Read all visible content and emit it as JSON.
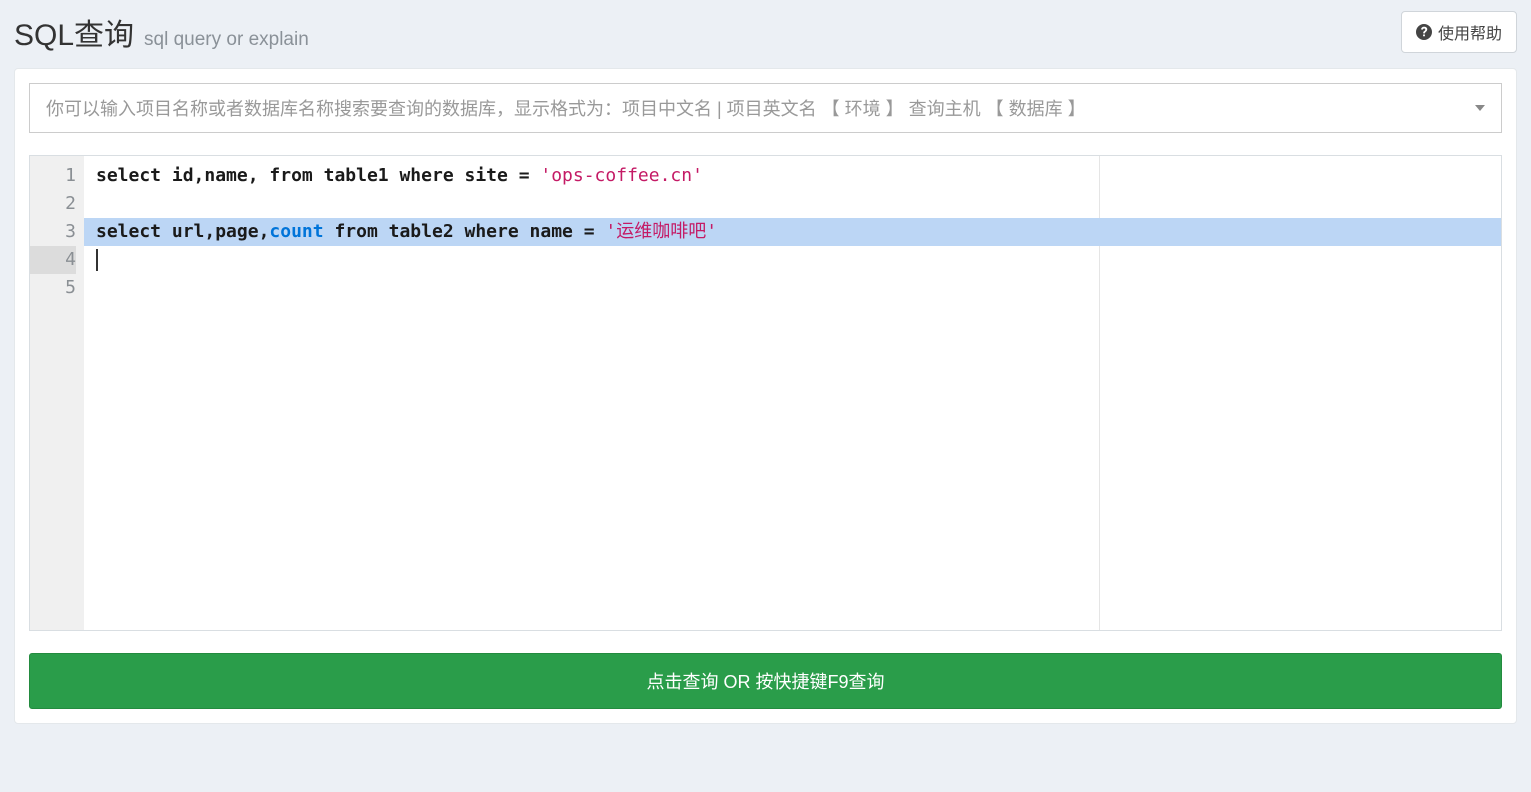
{
  "header": {
    "title": "SQL查询",
    "subtitle": "sql query or explain",
    "help_label": "使用帮助"
  },
  "db_select": {
    "placeholder": "你可以输入项目名称或者数据库名称搜索要查询的数据库，显示格式为：项目中文名 | 项目英文名 【 环境 】 查询主机 【 数据库 】"
  },
  "editor": {
    "line_numbers": [
      "1",
      "2",
      "3",
      "4",
      "5"
    ],
    "active_line": 4,
    "selected_line": 3,
    "lines": {
      "l1": {
        "t1": "select",
        "t2": " id,name, ",
        "t3": "from",
        "t4": " table1 ",
        "t5": "where",
        "t6": " site ",
        "t7": "=",
        "t8": " ",
        "t9": "'ops-coffee.cn'"
      },
      "l3": {
        "t1": "select",
        "t2": " url,page,",
        "t3": "count",
        "t4": " ",
        "t5": "from",
        "t6": " table2 ",
        "t7": "where",
        "t8": " name ",
        "t9": "=",
        "t10": " ",
        "t11": "'运维咖啡吧'"
      }
    }
  },
  "run_button": "点击查询 OR 按快捷键F9查询"
}
